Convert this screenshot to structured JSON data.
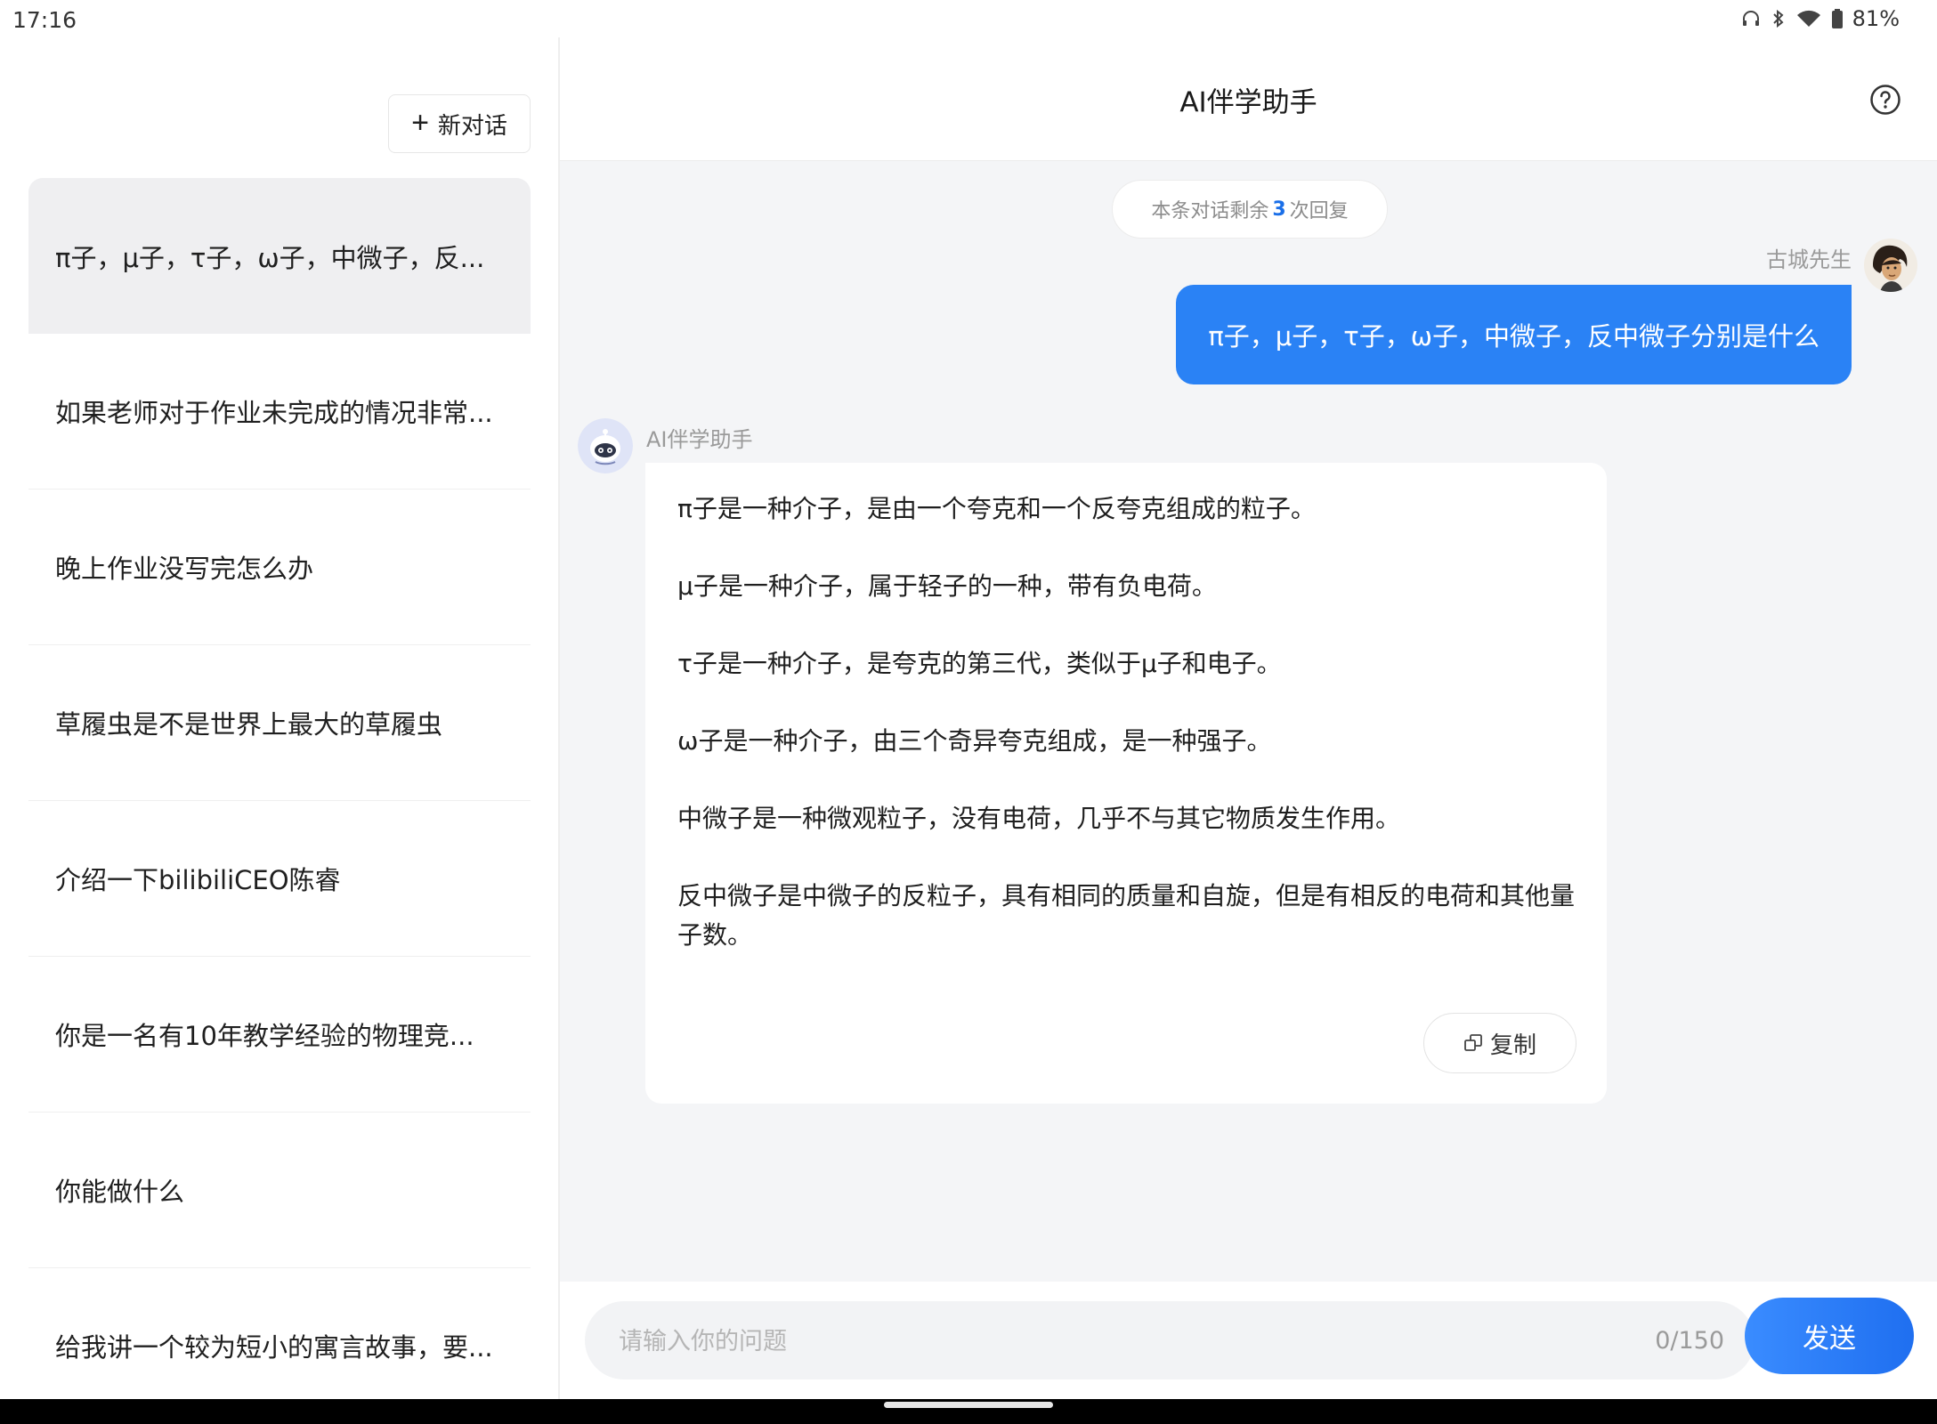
{
  "status_bar": {
    "time": "17:16",
    "battery": "81%"
  },
  "sidebar": {
    "new_chat_label": "新对话",
    "conversations": [
      "π子，μ子，τ子，ω子，中微子，反...",
      "如果老师对于作业未完成的情况非常...",
      "晚上作业没写完怎么办",
      "草履虫是不是世界上最大的草履虫",
      "介绍一下bilibiliCEO陈睿",
      "你是一名有10年教学经验的物理竞...",
      "你能做什么",
      "给我讲一个较为短小的寓言故事，要..."
    ]
  },
  "header": {
    "title": "AI伴学助手"
  },
  "chat": {
    "remaining_prefix": "本条对话剩余",
    "remaining_count": "3",
    "remaining_suffix": "次回复",
    "user": {
      "name": "古城先生",
      "message": "π子，μ子，τ子，ω子，中微子，反中微子分别是什么"
    },
    "bot": {
      "name": "AI伴学助手",
      "paragraphs": [
        "π子是一种介子，是由一个夸克和一个反夸克组成的粒子。",
        "μ子是一种介子，属于轻子的一种，带有负电荷。",
        "τ子是一种介子，是夸克的第三代，类似于μ子和电子。",
        "ω子是一种介子，由三个奇异夸克组成，是一种强子。",
        "中微子是一种微观粒子，没有电荷，几乎不与其它物质发生作用。",
        "反中微子是中微子的反粒子，具有相同的质量和自旋，但是有相反的电荷和其他量子数。"
      ],
      "copy_label": "复制"
    }
  },
  "input": {
    "placeholder": "请输入你的问题",
    "value": "",
    "char_count": "0/150",
    "send_label": "发送"
  }
}
